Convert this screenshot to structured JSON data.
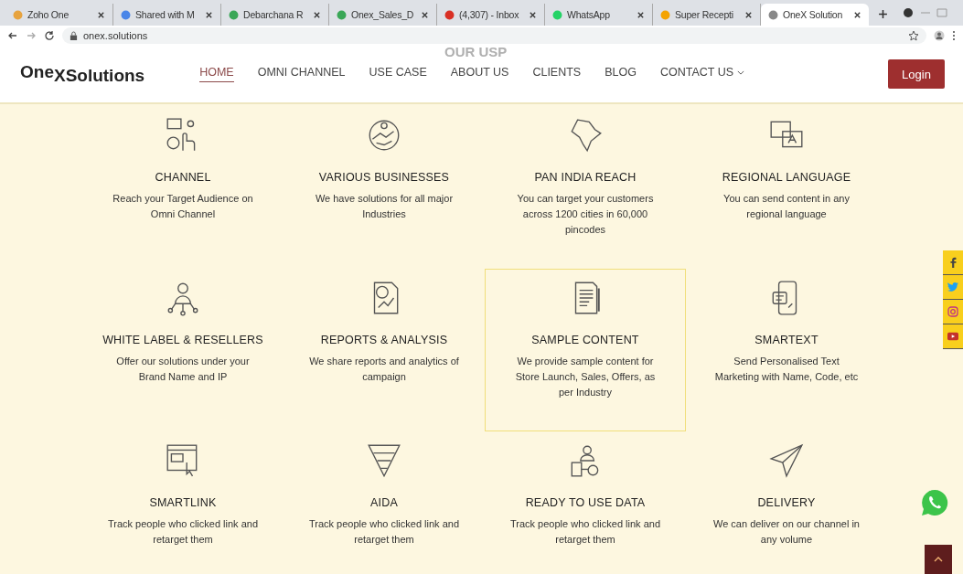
{
  "browser": {
    "tabs": [
      {
        "title": "Zoho One",
        "selected": false
      },
      {
        "title": "Shared with M",
        "selected": false
      },
      {
        "title": "Debarchana R",
        "selected": false
      },
      {
        "title": "Onex_Sales_D",
        "selected": false
      },
      {
        "title": "(4,307) - Inbox",
        "selected": false
      },
      {
        "title": "WhatsApp",
        "selected": false
      },
      {
        "title": "Super Recepti",
        "selected": false
      },
      {
        "title": "OneX Solution",
        "selected": true
      }
    ],
    "address": "onex.solutions"
  },
  "header": {
    "logo": "One$_{XSolutions}$",
    "faded_heading": "OUR USP",
    "nav": [
      {
        "label": "HOME",
        "selected": true,
        "has_menu": false
      },
      {
        "label": "OMNI CHANNEL",
        "selected": false,
        "has_menu": false
      },
      {
        "label": "USE CASE",
        "selected": false,
        "has_menu": false
      },
      {
        "label": "ABOUT US",
        "selected": false,
        "has_menu": false
      },
      {
        "label": "CLIENTS",
        "selected": false,
        "has_menu": false
      },
      {
        "label": "BLOG",
        "selected": false,
        "has_menu": false
      },
      {
        "label": "CONTACT US",
        "selected": false,
        "has_menu": true
      }
    ],
    "login": "Login"
  },
  "features": [
    {
      "title": "CHANNEL",
      "text": "Reach your Target Audience on Omni Channel",
      "selected": false
    },
    {
      "title": "VARIOUS BUSINESSES",
      "text": "We have solutions for all major Industries",
      "selected": false
    },
    {
      "title": "PAN INDIA REACH",
      "text": "You can target your customers across 1200 cities in 60,000 pincodes",
      "selected": false
    },
    {
      "title": "REGIONAL LANGUAGE",
      "text": "You can send content in any regional language",
      "selected": false
    },
    {
      "title": "WHITE LABEL & RESELLERS",
      "text": "Offer our solutions under your Brand Name and IP",
      "selected": false
    },
    {
      "title": "REPORTS & ANALYSIS",
      "text": "We share reports and analytics of campaign",
      "selected": false
    },
    {
      "title": "SAMPLE CONTENT",
      "text": "We provide sample content for Store Launch, Sales, Offers, as per Industry",
      "selected": true
    },
    {
      "title": "SMARTEXT",
      "text": "Send Personalised Text Marketing with Name, Code, etc",
      "selected": false
    },
    {
      "title": "SMARTLINK",
      "text": "Track people who clicked link and retarget them",
      "selected": false
    },
    {
      "title": "AIDA",
      "text": "Track people who clicked link and retarget them",
      "selected": false
    },
    {
      "title": "READY TO USE DATA",
      "text": "Track people who clicked link and retarget them",
      "selected": false
    },
    {
      "title": "DELIVERY",
      "text": "We can deliver on our channel in any volume",
      "selected": false
    }
  ]
}
